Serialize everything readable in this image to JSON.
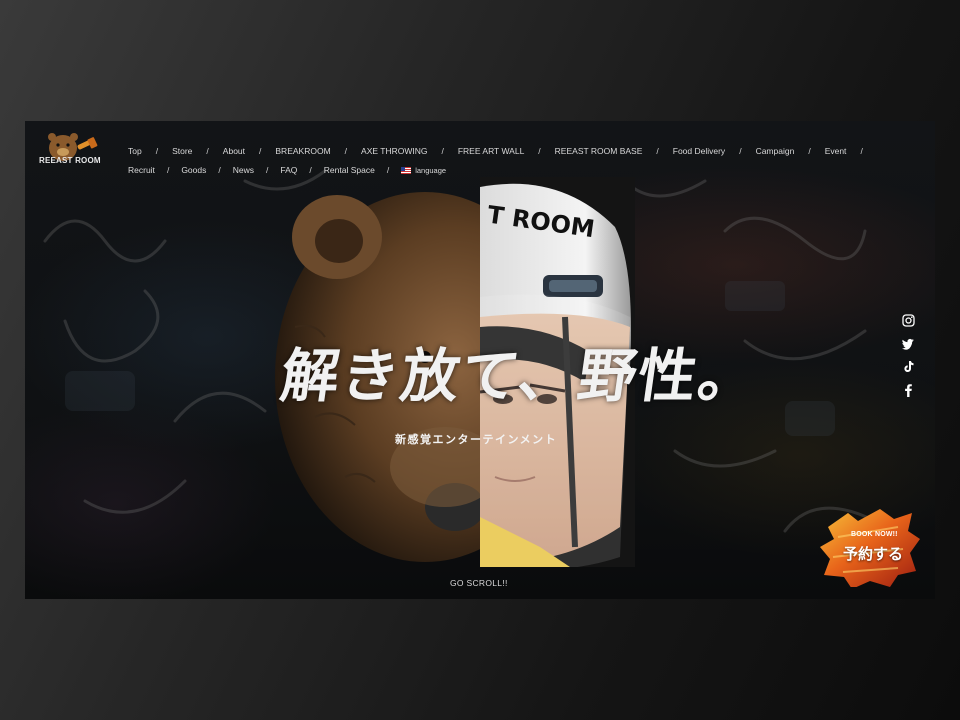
{
  "logo": {
    "text": "REEAST ROOM"
  },
  "nav": {
    "row1": [
      "Top",
      "Store",
      "About",
      "BREAKROOM",
      "AXE THROWING",
      "FREE ART WALL",
      "REEAST ROOM BASE",
      "Food Delivery",
      "Campaign",
      "Event"
    ],
    "row2": [
      "Recruit",
      "Goods",
      "News",
      "FAQ",
      "Rental Space"
    ],
    "separator": "/",
    "language": "language"
  },
  "hero": {
    "headline": "解き放て、野性。",
    "subline": "新感覚エンターテインメント",
    "helmet_text": "T ROOM",
    "scroll_text": "GO SCROLL!!"
  },
  "social": {
    "icons": [
      "instagram-icon",
      "twitter-icon",
      "tiktok-icon",
      "facebook-icon"
    ]
  },
  "cta": {
    "en": "BOOK NOW!!",
    "jp": "予約する"
  },
  "colors": {
    "accent": "#e85a14",
    "text": "#d9d9d9",
    "background": "#0f1113"
  }
}
